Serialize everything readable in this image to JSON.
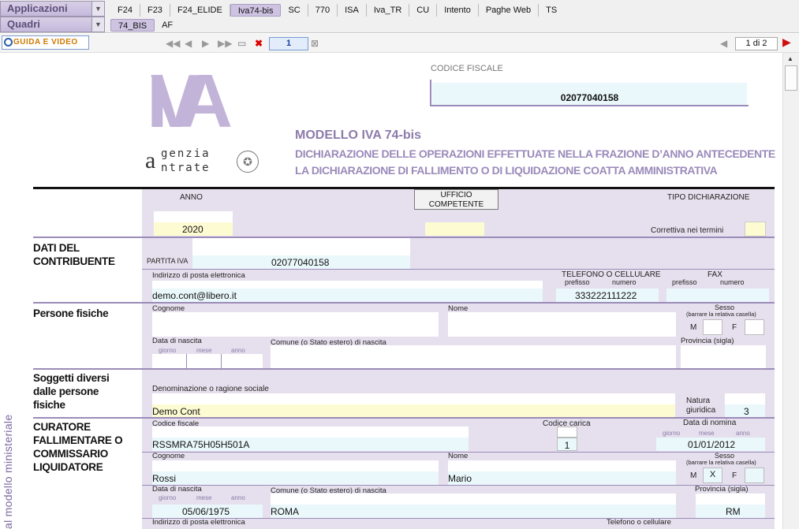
{
  "nav": {
    "applicazioni_label": "Applicazioni",
    "quadri_label": "Quadri",
    "app_tabs": [
      "F24",
      "F23",
      "F24_ELIDE",
      "Iva74-bis",
      "SC",
      "770",
      "ISA",
      "Iva_TR",
      "CU",
      "Intento",
      "Paghe Web",
      "TS"
    ],
    "quadri_tabs": [
      "74_BIS",
      "AF"
    ]
  },
  "toolbar": {
    "guide_label": "GUIDA E VIDEO",
    "page_value": "1",
    "page_count": "1 di 2"
  },
  "header": {
    "logo_letters": "IVA",
    "agency_line1": "genzia",
    "agency_line2": "ntrate",
    "codice_fiscale_label": "CODICE FISCALE",
    "codice_fiscale": "02077040158",
    "model_title": "MODELLO IVA 74-bis",
    "model_sub1": "DICHIARAZIONE DELLE OPERAZIONI EFFETTUATE NELLA FRAZIONE D’ANNO ANTECEDENTE",
    "model_sub2": "LA DICHIARAZIONE DI FALLIMENTO O DI LIQUIDAZIONE COATTA AMMINISTRATIVA"
  },
  "top": {
    "anno_label": "ANNO",
    "anno": "2020",
    "ufficio_label": "UFFICIO COMPETENTE",
    "tipo_label": "TIPO DICHIARAZIONE",
    "correttiva_label": "Correttiva nei termini"
  },
  "contribuente": {
    "section": "DATI DEL CONTRIBUENTE",
    "piva_label": "PARTITA IVA",
    "piva": "02077040158",
    "email_label": "Indirizzo di posta elettronica",
    "email": "demo.cont@libero.it",
    "tel_label": "TELEFONO O CELLULARE",
    "prefisso": "prefisso",
    "numero": "numero",
    "tel": "333222111222",
    "fax_label": "FAX",
    "fax_prefisso": "prefisso",
    "fax_numero": "numero"
  },
  "persone": {
    "section": "Persone fisiche",
    "cognome_label": "Cognome",
    "nome_label": "Nome",
    "sesso_label": "Sesso",
    "sesso_sub": "(barrare la relativa casella)",
    "m": "M",
    "f": "F",
    "nascita_label": "Data di nascita",
    "giorno": "giorno",
    "mese": "mese",
    "anno": "anno",
    "comune_label": "Comune (o Stato estero) di nascita",
    "provincia_label": "Provincia (sigla)"
  },
  "soggetti": {
    "section": "Soggetti diversi dalle persone fisiche",
    "denom_label": "Denominazione o ragione sociale",
    "denom": "Demo Cont",
    "natura_label": "Natura giuridica",
    "natura": "3"
  },
  "curatore": {
    "section": "CURATORE FALLIMENTARE O COMMISSARIO LIQUIDATORE",
    "cf_label": "Codice fiscale",
    "cf": "RSSMRA75H05H501A",
    "carica_label": "Codice carica",
    "carica": "1",
    "nomina_label": "Data di nomina",
    "giorno": "giorno",
    "mese": "mese",
    "anno": "anno",
    "nomina": "01/01/2012",
    "cognome_label": "Cognome",
    "cognome": "Rossi",
    "nome_label": "Nome",
    "nome": "Mario",
    "sesso_label": "Sesso",
    "sesso_sub": "(barrare la relativa casella)",
    "m": "M",
    "m_mark": "X",
    "f": "F",
    "nascita_label": "Data di nascita",
    "nascita": "05/06/1975",
    "comune_label": "Comune (o Stato estero) di nascita",
    "comune": "ROMA",
    "provincia_label": "Provincia (sigla)",
    "provincia": "RM",
    "email_label": "Indirizzo di posta elettronica",
    "tel_label": "Telefono o cellulare"
  },
  "side_text": "al modello ministeriale",
  "colors": {
    "accent": "#9b8bb8",
    "field": "#eaf8fb",
    "yellow": "#fdfbd2",
    "panel": "#e6e0ee"
  }
}
